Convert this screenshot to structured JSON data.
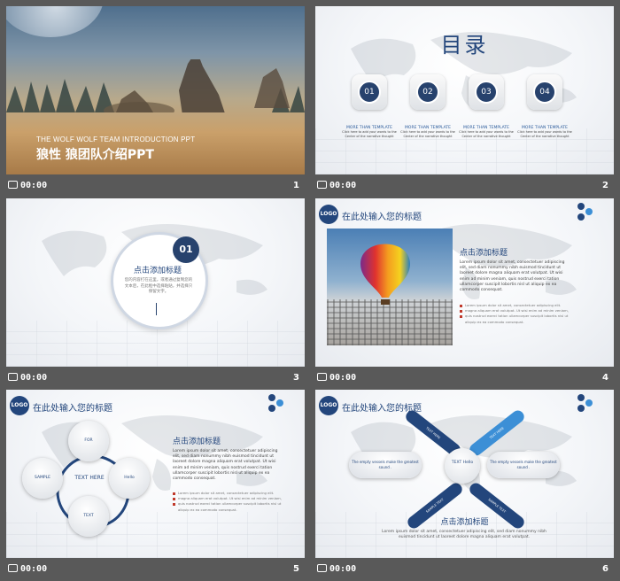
{
  "slides": [
    {
      "time": "00:00",
      "number": "1",
      "title_en": "THE WOLF WOLF TEAM INTRODUCTION PPT",
      "title_cn": "狼性 狼团队介绍PPT"
    },
    {
      "time": "00:00",
      "number": "2",
      "title": "目录",
      "items": [
        {
          "num": "01",
          "head": "MORE THAN TEMPLATE",
          "text": "Click here to add your words to the Center of the narrative thought"
        },
        {
          "num": "02",
          "head": "MORE THAN TEMPLATE",
          "text": "Click here to add your words to the Center of the narrative thought"
        },
        {
          "num": "03",
          "head": "MORE THAN TEMPLATE",
          "text": "Click here to add your words to the Center of the narrative thought"
        },
        {
          "num": "04",
          "head": "MORE THAN TEMPLATE",
          "text": "Click here to add your words to the Center of the narrative thought"
        }
      ]
    },
    {
      "time": "00:00",
      "number": "3",
      "badge": "01",
      "heading": "点击添加标题",
      "text": "您的内容打在这里，或者通过复制您的文本后，在此框中选择粘贴，并选择只保留文字。"
    },
    {
      "time": "00:00",
      "number": "4",
      "logo": "LOGO",
      "header": "在此处输入您的标题",
      "heading": "点击添加标题",
      "para": "Lorem ipsum dolor sit amet, consectetuer adipiscing elit, sed diam nonummy nibh euismod tincidunt ut laoreet dolore magna aliquam erat volutpat. Ut wisi enim ad minim veniam, quis nostrud exerci tation ullamcorper suscipit lobortis nisl ut aliquip ex ea commodo consequat.",
      "bullets": [
        "Lorem ipsum dolor sit amet, consectetuer adipiscing elit.",
        "magna aliquam erat volutpat. Ut wisi enim ad minim veniam,",
        "quis nostrud exerci tation ullamcorper suscipit lobortis nisl ut",
        "aliquip ex ea commodo consequat."
      ]
    },
    {
      "time": "00:00",
      "number": "5",
      "logo": "LOGO",
      "header": "在此处输入您的标题",
      "center": "TEXT HERE",
      "nodes": [
        "FOR",
        "Hello",
        "TEXT",
        "SAMPLE"
      ],
      "heading": "点击添加标题",
      "para": "Lorem ipsum dolor sit amet, consectetuer adipiscing elit, sed diam nonummy nibh euismod tincidunt ut laoreet dolore magna aliquam erat volutpat. Ut wisi enim ad minim veniam, quis nostrud exerci tation ullamcorper suscipit lobortis nisl ut aliquip ex ea commodo consequat.",
      "bullets": [
        "Lorem ipsum dolor sit amet, consectetuer adipiscing elit.",
        "magna aliquam erat volutpat. Ut wisi enim ad minim veniam,",
        "quis nostrud exerci tation ullamcorper suscipit lobortis nisl ut",
        "aliquip ex ea commodo consequat."
      ]
    },
    {
      "time": "00:00",
      "number": "6",
      "logo": "LOGO",
      "header": "在此处输入您的标题",
      "center": "TEXT Hello",
      "pills": [
        "TEXT HERE",
        "TEXT HERE",
        "SAMPLE TEXT",
        "SAMPLE TEXT"
      ],
      "left_caption": "The empty vessels make the greatest sound .",
      "right_caption": "The empty vessels make the greatest sound .",
      "heading": "点击添加标题",
      "para": "Lorem ipsum dolor sit amet, consectetuer adipiscing elit, sed diam nonummy nibh euismod tincidunt ut laoreet dolore magna aliquam erat volutpat."
    }
  ],
  "colors": {
    "navy": "#23467c",
    "accent_blue": "#3c8fd6",
    "bar_bg": "#595959"
  }
}
